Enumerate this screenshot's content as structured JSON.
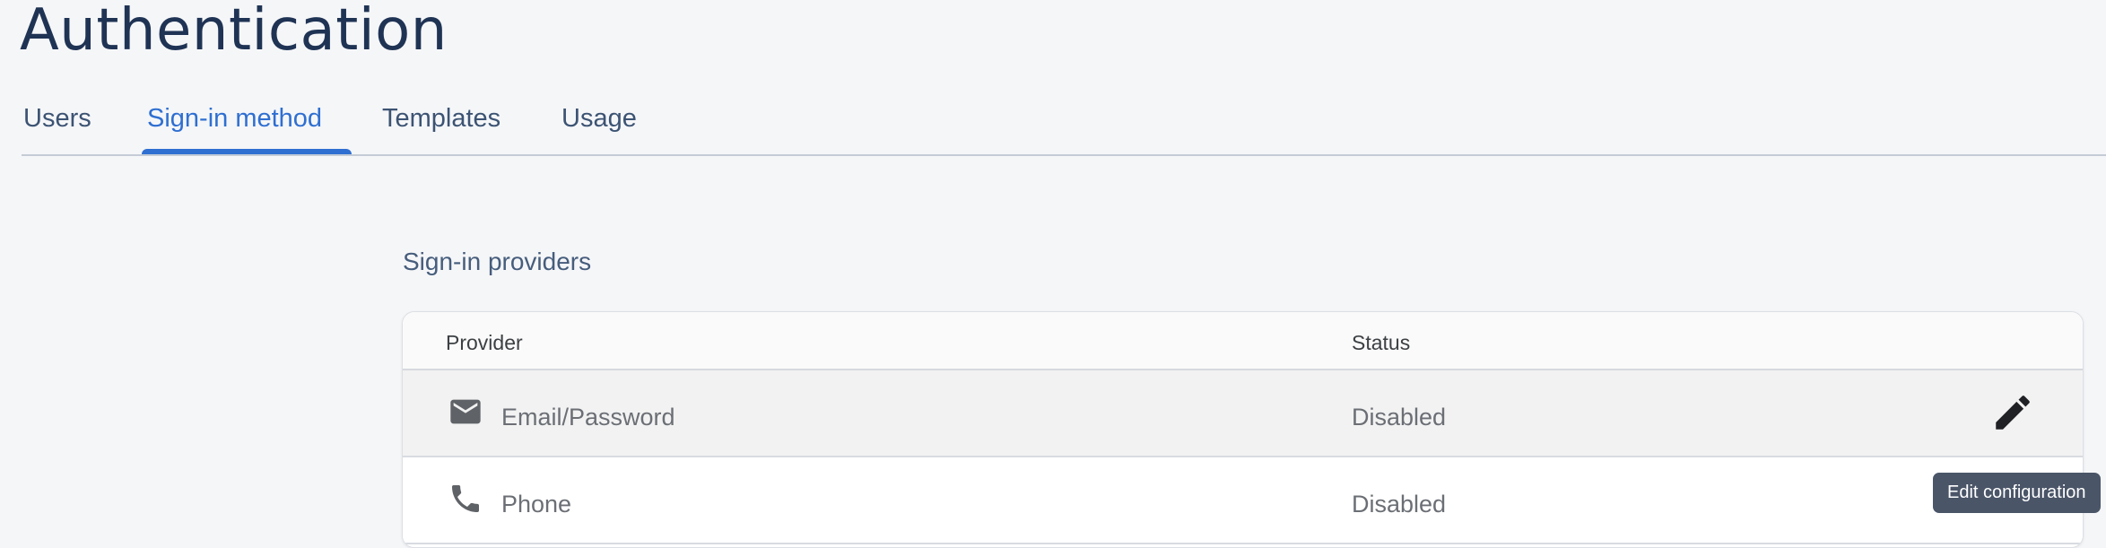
{
  "page": {
    "title": "Authentication"
  },
  "tabs": [
    {
      "label": "Users",
      "active": false
    },
    {
      "label": "Sign-in method",
      "active": true
    },
    {
      "label": "Templates",
      "active": false
    },
    {
      "label": "Usage",
      "active": false
    }
  ],
  "providers_section": {
    "title": "Sign-in providers",
    "columns": {
      "provider": "Provider",
      "status": "Status"
    },
    "rows": [
      {
        "icon": "email-icon",
        "name": "Email/Password",
        "status": "Disabled"
      },
      {
        "icon": "phone-icon",
        "name": "Phone",
        "status": "Disabled"
      }
    ]
  },
  "row_actions": {
    "edit_icon": "pencil-icon",
    "tooltip": "Edit configuration"
  },
  "colors": {
    "accent": "#2f6fd1",
    "title": "#1f3354",
    "tooltip_bg": "#4a5568"
  }
}
